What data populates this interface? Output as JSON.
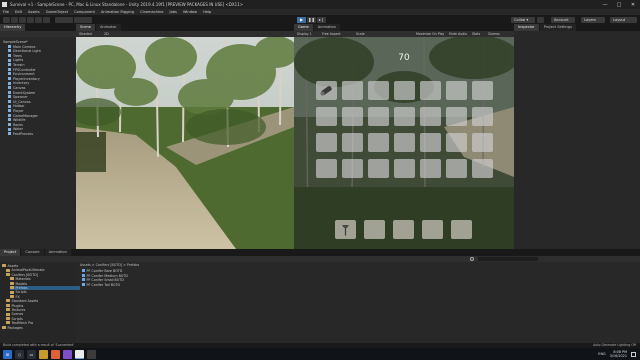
{
  "window": {
    "title": "Survival +1 - SampleScene - PC, Mac & Linux Standalone - Unity 2019.4.19f1 [PREVIEW PACKAGES IN USE] <DX11>",
    "controls": [
      "—",
      "□",
      "✕"
    ]
  },
  "menu": [
    "File",
    "Edit",
    "Assets",
    "GameObject",
    "Component",
    "Animation Rigging",
    "Cinemachine",
    "Jobs",
    "Window",
    "Help"
  ],
  "toolbar": {
    "collab_label": "Collab ▾",
    "account_label": "Account",
    "layers_label": "Layers",
    "layout_label": "Layout"
  },
  "hierarchy": {
    "tab": "Hierarchy",
    "scene_name": "SampleScene*",
    "items": [
      "Main Camera",
      "Directional Light",
      "Trees",
      "Lights",
      "Terrain",
      "FPSController",
      "Environment",
      "PlayerInventory",
      "Inventory",
      "Canvas",
      "EventSystem",
      "Spawner",
      "UI_Canvas",
      "Hotbar",
      "Player",
      "GameManager",
      "Wildlife",
      "Rocks",
      "Water",
      "PostProcess"
    ]
  },
  "scene": {
    "tabs": [
      "Scene",
      "Animator"
    ],
    "shading": "Shaded",
    "mode": "2D"
  },
  "game": {
    "tabs": [
      "Game",
      "Animation"
    ],
    "display": "Display 1",
    "aspect": "Free Aspect",
    "scale": "Scale",
    "options": [
      "Maximize On Play",
      "Mute Audio",
      "Stats",
      "Gizmos"
    ],
    "inventory_count": "70",
    "grid_rows": 4,
    "grid_cols": 7,
    "hotbar_slots": 5,
    "item_slot_icon": "log-icon",
    "hotbar_item_icon": "axe-icon"
  },
  "inspector": {
    "tabs": [
      "Inspector",
      "Project Settings"
    ]
  },
  "project": {
    "tabs": [
      "Project",
      "Console",
      "Animation"
    ],
    "breadcrumb": "Assets > Conifers [BOTD] > Prefabs",
    "tree": [
      "Assets",
      "AnimalPackUltimate",
      "Conifers [BOTD]",
      "Materials",
      "Models",
      "Prefabs",
      "Scripts",
      "FX",
      "Standard Assets",
      "Plugins",
      "Textures",
      "Scenes",
      "Scripts",
      "TextMesh Pro",
      "Packages"
    ],
    "selected_folder": "Prefabs",
    "files": [
      "PF Conifer Bare BOTD",
      "PF Conifer Medium BOTD",
      "PF Conifer Small BOTD",
      "PF Conifer Tall BOTD"
    ]
  },
  "status": {
    "text": "Build completed with a result of 'Succeeded'",
    "right": "Auto Generate Lighting Off"
  },
  "taskbar": {
    "clock": "8:08 PM",
    "date": "3/16/2021",
    "lang": "ENG"
  }
}
